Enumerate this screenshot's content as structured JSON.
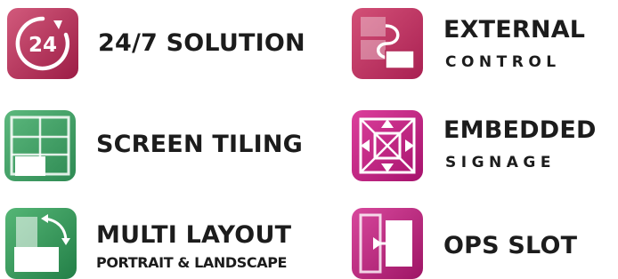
{
  "features": [
    {
      "title": "24/7 SOLUTION",
      "icon": "clock-24-icon",
      "color": "#b8325a"
    },
    {
      "title": "EXTERNAL",
      "subtitle": "CONTROL",
      "icon": "external-control-icon",
      "color": "#c43a63"
    },
    {
      "title": "SCREEN TILING",
      "icon": "screen-tiling-icon",
      "color": "#3e9a62"
    },
    {
      "title": "EMBEDDED",
      "subtitle": "SIGNAGE",
      "icon": "embedded-signage-icon",
      "color": "#c62185"
    },
    {
      "title": "MULTI LAYOUT",
      "subtitle": "PORTRAIT & LANDSCAPE",
      "icon": "multi-layout-icon",
      "color": "#2f9a55"
    },
    {
      "title": "OPS SLOT",
      "icon": "ops-slot-icon",
      "color": "#c42e86"
    }
  ]
}
